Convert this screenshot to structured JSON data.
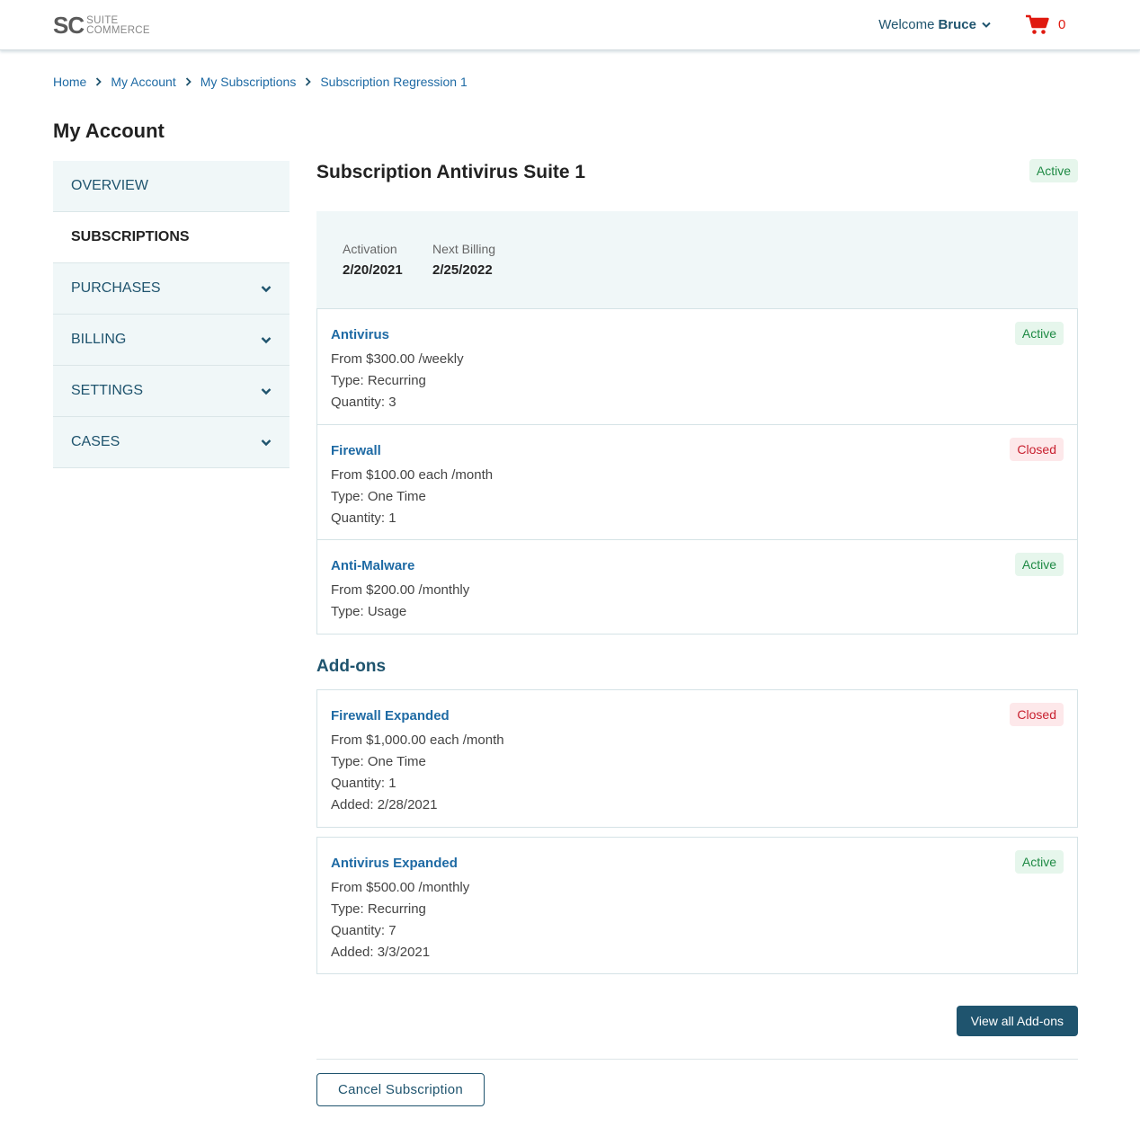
{
  "header": {
    "logo_sc": "SC",
    "logo_line1": "SUITE",
    "logo_line2": "COMMERCE",
    "welcome_label": "Welcome",
    "user_name": "Bruce",
    "cart_count": "0",
    "cart_color": "#e0190f"
  },
  "breadcrumb": [
    "Home",
    "My Account",
    "My Subscriptions",
    "Subscription Regression 1"
  ],
  "page_title": "My Account",
  "sidebar": {
    "items": [
      {
        "label": "OVERVIEW",
        "expandable": false,
        "active": false
      },
      {
        "label": "SUBSCRIPTIONS",
        "expandable": false,
        "active": true
      },
      {
        "label": "PURCHASES",
        "expandable": true,
        "active": false
      },
      {
        "label": "BILLING",
        "expandable": true,
        "active": false
      },
      {
        "label": "SETTINGS",
        "expandable": true,
        "active": false
      },
      {
        "label": "CASES",
        "expandable": true,
        "active": false
      }
    ]
  },
  "subscription": {
    "title": "Subscription Antivirus Suite 1",
    "status": "Active",
    "activation_label": "Activation",
    "activation_value": "2/20/2021",
    "next_billing_label": "Next Billing",
    "next_billing_value": "2/25/2022"
  },
  "line_items": [
    {
      "name": "Antivirus",
      "status": "Active",
      "lines": [
        "From $300.00 /weekly",
        "Type: Recurring",
        "Quantity: 3"
      ]
    },
    {
      "name": "Firewall",
      "status": "Closed",
      "lines": [
        "From $100.00 each /month",
        "Type: One Time",
        "Quantity: 1"
      ]
    },
    {
      "name": "Anti-Malware",
      "status": "Active",
      "lines": [
        "From $200.00 /monthly",
        "Type: Usage"
      ]
    }
  ],
  "addons": {
    "title": "Add-ons",
    "items": [
      {
        "name": "Firewall Expanded",
        "status": "Closed",
        "lines": [
          "From $1,000.00 each /month",
          "Type: One Time",
          "Quantity: 1",
          "Added: 2/28/2021"
        ]
      },
      {
        "name": "Antivirus Expanded",
        "status": "Active",
        "lines": [
          "From $500.00 /monthly",
          "Type: Recurring",
          "Quantity: 7",
          "Added: 3/3/2021"
        ]
      }
    ],
    "view_all_label": "View all Add-ons"
  },
  "cancel_label": "Cancel Subscription",
  "colors": {
    "brand": "#1f546e",
    "link": "#1e6aa4",
    "active_bg": "#e6f6ec",
    "active_text": "#1e8a44",
    "closed_bg": "#fde8ea",
    "closed_text": "#c8202f"
  }
}
